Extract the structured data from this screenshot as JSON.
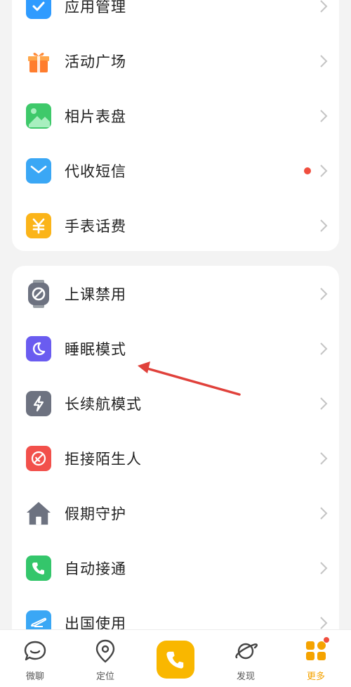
{
  "group1": {
    "items": [
      {
        "label": "应用管理",
        "icon": "app-manage-icon",
        "color": "#2f9bff"
      },
      {
        "label": "活动广场",
        "icon": "gift-icon",
        "color": "#ff7d2e"
      },
      {
        "label": "相片表盘",
        "icon": "photo-icon",
        "color": "#3ec96a"
      },
      {
        "label": "代收短信",
        "icon": "mail-icon",
        "color": "#3aa7f5",
        "badge": true
      },
      {
        "label": "手表话费",
        "icon": "yuan-icon",
        "color": "#fbb419"
      }
    ]
  },
  "group2": {
    "items": [
      {
        "label": "上课禁用",
        "icon": "class-disable-icon",
        "color": "#6d7280"
      },
      {
        "label": "睡眠模式",
        "icon": "moon-icon",
        "color": "#6a5cf0"
      },
      {
        "label": "长续航模式",
        "icon": "lightning-icon",
        "color": "#6d7280"
      },
      {
        "label": "拒接陌生人",
        "icon": "reject-call-icon",
        "color": "#f2504b"
      },
      {
        "label": "假期守护",
        "icon": "house-icon",
        "color": "#6d7280"
      },
      {
        "label": "自动接通",
        "icon": "phone-icon",
        "color": "#34c66b"
      },
      {
        "label": "出国使用",
        "icon": "plane-icon",
        "color": "#3aa7f5"
      }
    ]
  },
  "tabbar": {
    "tabs": [
      {
        "label": "微聊",
        "icon": "chat-icon"
      },
      {
        "label": "定位",
        "icon": "location-icon"
      },
      {
        "label": "",
        "icon": "call-icon"
      },
      {
        "label": "发现",
        "icon": "planet-icon"
      },
      {
        "label": "更多",
        "icon": "more-icon",
        "active": true,
        "badge": true
      }
    ],
    "accent": "#f9b700"
  },
  "colors": {
    "background": "#f3f3f3",
    "card": "#ffffff",
    "badge": "#f04e3e",
    "annotation_arrow": "#e0413b"
  }
}
